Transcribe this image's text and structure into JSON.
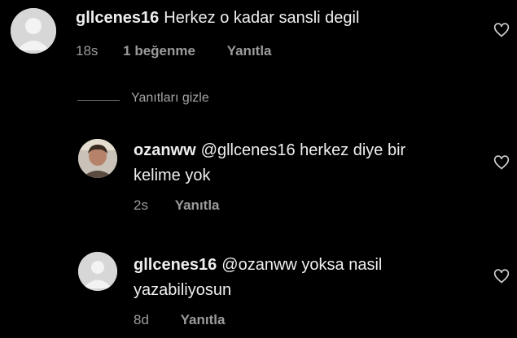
{
  "comments": [
    {
      "username": "gllcenes16",
      "text": "Herkez o kadar sansli degil",
      "time": "18s",
      "likes": "1 beğenme",
      "reply": "Yanıtla"
    }
  ],
  "hide_replies_label": "Yanıtları gizle",
  "replies": [
    {
      "username": "ozanww",
      "text_line1": "@gllcenes16 herkez diye bir",
      "text_line2": "kelime yok",
      "time": "2s",
      "reply": "Yanıtla"
    },
    {
      "username": "gllcenes16",
      "text_line1": "@ozanww yoksa nasil",
      "text_line2": "yazabiliyosun",
      "time": "8d",
      "reply": "Yanıtla"
    }
  ],
  "colors": {
    "background": "#000000",
    "text": "#efefef",
    "meta": "#9b9b9b",
    "avatar_placeholder": "#d7d7d7"
  }
}
